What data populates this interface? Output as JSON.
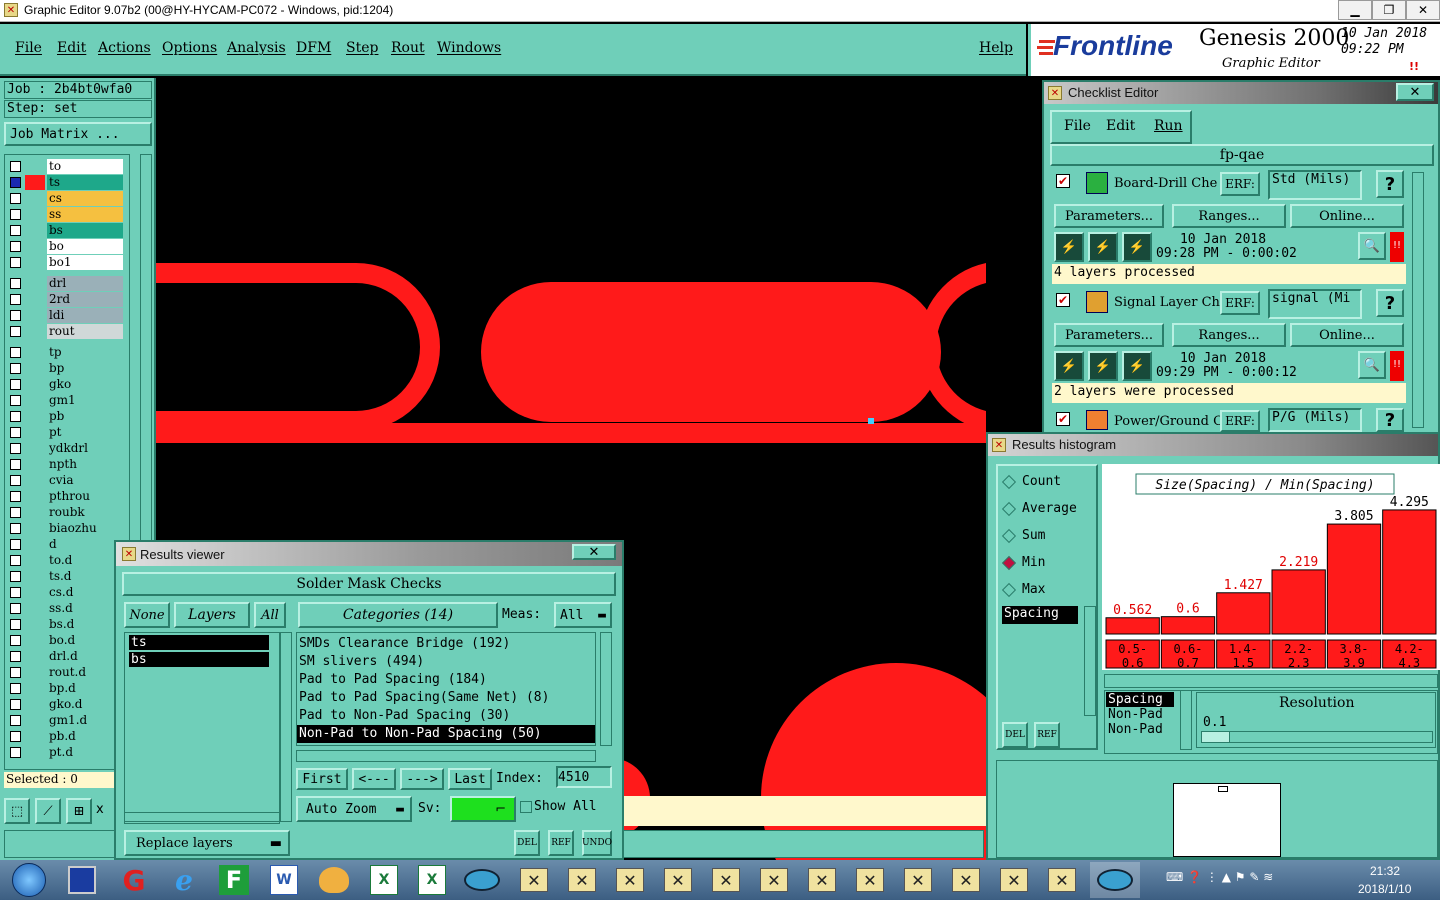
{
  "window": {
    "title": "Graphic Editor 9.07b2 (00@HY-HYCAM-PC072 - Windows, pid:1204)"
  },
  "menu": {
    "items": [
      "File",
      "Edit",
      "Actions",
      "Options",
      "Analysis",
      "DFM",
      "Step",
      "Rout",
      "Windows"
    ],
    "help": "Help"
  },
  "brand": {
    "logo": "Frontline",
    "product": "Genesis 2000",
    "subtitle": "Graphic Editor",
    "date": "10 Jan 2018",
    "time": "09:22  PM",
    "indicator": "!!"
  },
  "job": {
    "job_label": "Job : 2b4bt0wfa0",
    "step_label": "Step: set",
    "matrix_button": "Job Matrix ...",
    "selected": "Selected : 0"
  },
  "layers": [
    {
      "name": "to",
      "color": "#ffffff",
      "on": false
    },
    {
      "name": "ts",
      "color": "#1ea88a",
      "on": true,
      "work": true
    },
    {
      "name": "cs",
      "color": "#f5c040",
      "on": false
    },
    {
      "name": "ss",
      "color": "#f5c040",
      "on": false
    },
    {
      "name": "bs",
      "color": "#1ea88a",
      "on": false
    },
    {
      "name": "bo",
      "color": "#ffffff",
      "on": false
    },
    {
      "name": "bo1",
      "color": "#ffffff",
      "on": false
    },
    {
      "name": "drl",
      "color": "#9ab0b8",
      "on": false
    },
    {
      "name": "2rd",
      "color": "#9ab0b8",
      "on": false
    },
    {
      "name": "ldi",
      "color": "#9ab0b8",
      "on": false
    },
    {
      "name": "rout",
      "color": "#d0d8d8",
      "on": false
    },
    {
      "name": "tp",
      "color": "#6fcfb9",
      "on": false
    },
    {
      "name": "bp",
      "color": "#6fcfb9",
      "on": false
    },
    {
      "name": "gko",
      "color": "#6fcfb9",
      "on": false
    },
    {
      "name": "gm1",
      "color": "#6fcfb9",
      "on": false
    },
    {
      "name": "pb",
      "color": "#6fcfb9",
      "on": false
    },
    {
      "name": "pt",
      "color": "#6fcfb9",
      "on": false
    },
    {
      "name": "ydkdrl",
      "color": "#6fcfb9",
      "on": false
    },
    {
      "name": "npth",
      "color": "#6fcfb9",
      "on": false
    },
    {
      "name": "cvia",
      "color": "#6fcfb9",
      "on": false
    },
    {
      "name": "pthrou",
      "color": "#6fcfb9",
      "on": false
    },
    {
      "name": "roubk",
      "color": "#6fcfb9",
      "on": false
    },
    {
      "name": "biaozhu",
      "color": "#6fcfb9",
      "on": false
    },
    {
      "name": "d",
      "color": "#6fcfb9",
      "on": false
    },
    {
      "name": "to.d",
      "color": "#6fcfb9",
      "on": false
    },
    {
      "name": "ts.d",
      "color": "#6fcfb9",
      "on": false
    },
    {
      "name": "cs.d",
      "color": "#6fcfb9",
      "on": false
    },
    {
      "name": "ss.d",
      "color": "#6fcfb9",
      "on": false
    },
    {
      "name": "bs.d",
      "color": "#6fcfb9",
      "on": false
    },
    {
      "name": "bo.d",
      "color": "#6fcfb9",
      "on": false
    },
    {
      "name": "drl.d",
      "color": "#6fcfb9",
      "on": false
    },
    {
      "name": "rout.d",
      "color": "#6fcfb9",
      "on": false
    },
    {
      "name": "bp.d",
      "color": "#6fcfb9",
      "on": false
    },
    {
      "name": "gko.d",
      "color": "#6fcfb9",
      "on": false
    },
    {
      "name": "gm1.d",
      "color": "#6fcfb9",
      "on": false
    },
    {
      "name": "pb.d",
      "color": "#6fcfb9",
      "on": false
    },
    {
      "name": "pt.d",
      "color": "#6fcfb9",
      "on": false
    }
  ],
  "checklist": {
    "title": "Checklist Editor",
    "menu": [
      "File",
      "Edit",
      "Run"
    ],
    "name": "fp-qae",
    "erf_label": "ERF:",
    "items": [
      {
        "name": "Board-Drill Che",
        "erf": "Std (Mils)",
        "params": "Parameters...",
        "ranges": "Ranges...",
        "online": "Online...",
        "date": "10 Jan 2018",
        "time": "09:28 PM - 0:00:02",
        "status": "4 layers processed"
      },
      {
        "name": "Signal Layer Ch",
        "erf": "signal (Mi",
        "params": "Parameters...",
        "ranges": "Ranges...",
        "online": "Online...",
        "date": "10 Jan 2018",
        "time": "09:29 PM - 0:00:12",
        "status": "2 layers were processed"
      },
      {
        "name": "Power/Ground C",
        "erf": "P/G (Mils)"
      }
    ],
    "help": "?",
    "alert": "!!"
  },
  "histogram": {
    "title": "Results histogram",
    "modes": [
      "Count",
      "Average",
      "Sum",
      "Min",
      "Max"
    ],
    "selected_mode": "Min",
    "meas_list_top": "Spacing",
    "chart_title": "Size(Spacing) / Min(Spacing)",
    "del": "DEL",
    "ref": "REF",
    "list": [
      "Spacing",
      "Non-Pad",
      "Non-Pad"
    ],
    "resolution_label": "Resolution",
    "resolution_value": "0.1"
  },
  "chart_data": {
    "type": "bar",
    "title": "Size(Spacing) / Min(Spacing)",
    "categories": [
      "0.5-0.6",
      "0.6-0.7",
      "1.4-1.5",
      "2.2-2.3",
      "3.8-3.9",
      "4.2-4.3"
    ],
    "category_lines": [
      [
        "0.5-",
        "0.6"
      ],
      [
        "0.6-",
        "0.7"
      ],
      [
        "1.4-",
        "1.5"
      ],
      [
        "2.2-",
        "2.3"
      ],
      [
        "3.8-",
        "3.9"
      ],
      [
        "4.2-",
        "4.3"
      ]
    ],
    "values": [
      0.562,
      0.6,
      1.427,
      2.219,
      3.805,
      4.295
    ],
    "value_labels": [
      "0.562",
      "0.6",
      "1.427",
      "2.219",
      "3.805",
      "4.295"
    ],
    "ylim": [
      0,
      4.5
    ],
    "bar_color": "#ff1a1a",
    "grid": false,
    "legend": "none"
  },
  "results": {
    "title": "Results viewer",
    "heading": "Solder Mask Checks",
    "none": "None",
    "layers": "Layers",
    "all": "All",
    "categories_label": "Categories (14)",
    "meas_label": "Meas:",
    "meas_value": "All",
    "layer_list": [
      "ts",
      "bs"
    ],
    "category_list": [
      "SMDs Clearance Bridge (192)",
      "SM slivers (494)",
      "Pad to Pad Spacing (184)",
      "Pad to Pad Spacing(Same Net) (8)",
      "Pad to Non-Pad Spacing (30)",
      "Non-Pad to Non-Pad Spacing (50)"
    ],
    "selected_category_index": 5,
    "first": "First",
    "prev": "<---",
    "next": "--->",
    "last": "Last",
    "index_label": "Index:",
    "index_value": "4510",
    "auto_zoom": "Auto Zoom",
    "sv_label": "Sv:",
    "show_all": "Show All",
    "replace_layers": "Replace layers",
    "del": "DEL",
    "ref": "REF",
    "undo": "UNDO"
  },
  "taskbar": {
    "time": "21:32",
    "date": "2018/1/10",
    "app_icons": [
      "start-orb-icon",
      "save-icon",
      "app-g-icon",
      "ie-icon",
      "frontline-f-icon",
      "word-icon",
      "shell-icon",
      "excel-icon",
      "excel2-icon",
      "eye-icon"
    ],
    "window_count": 12
  }
}
